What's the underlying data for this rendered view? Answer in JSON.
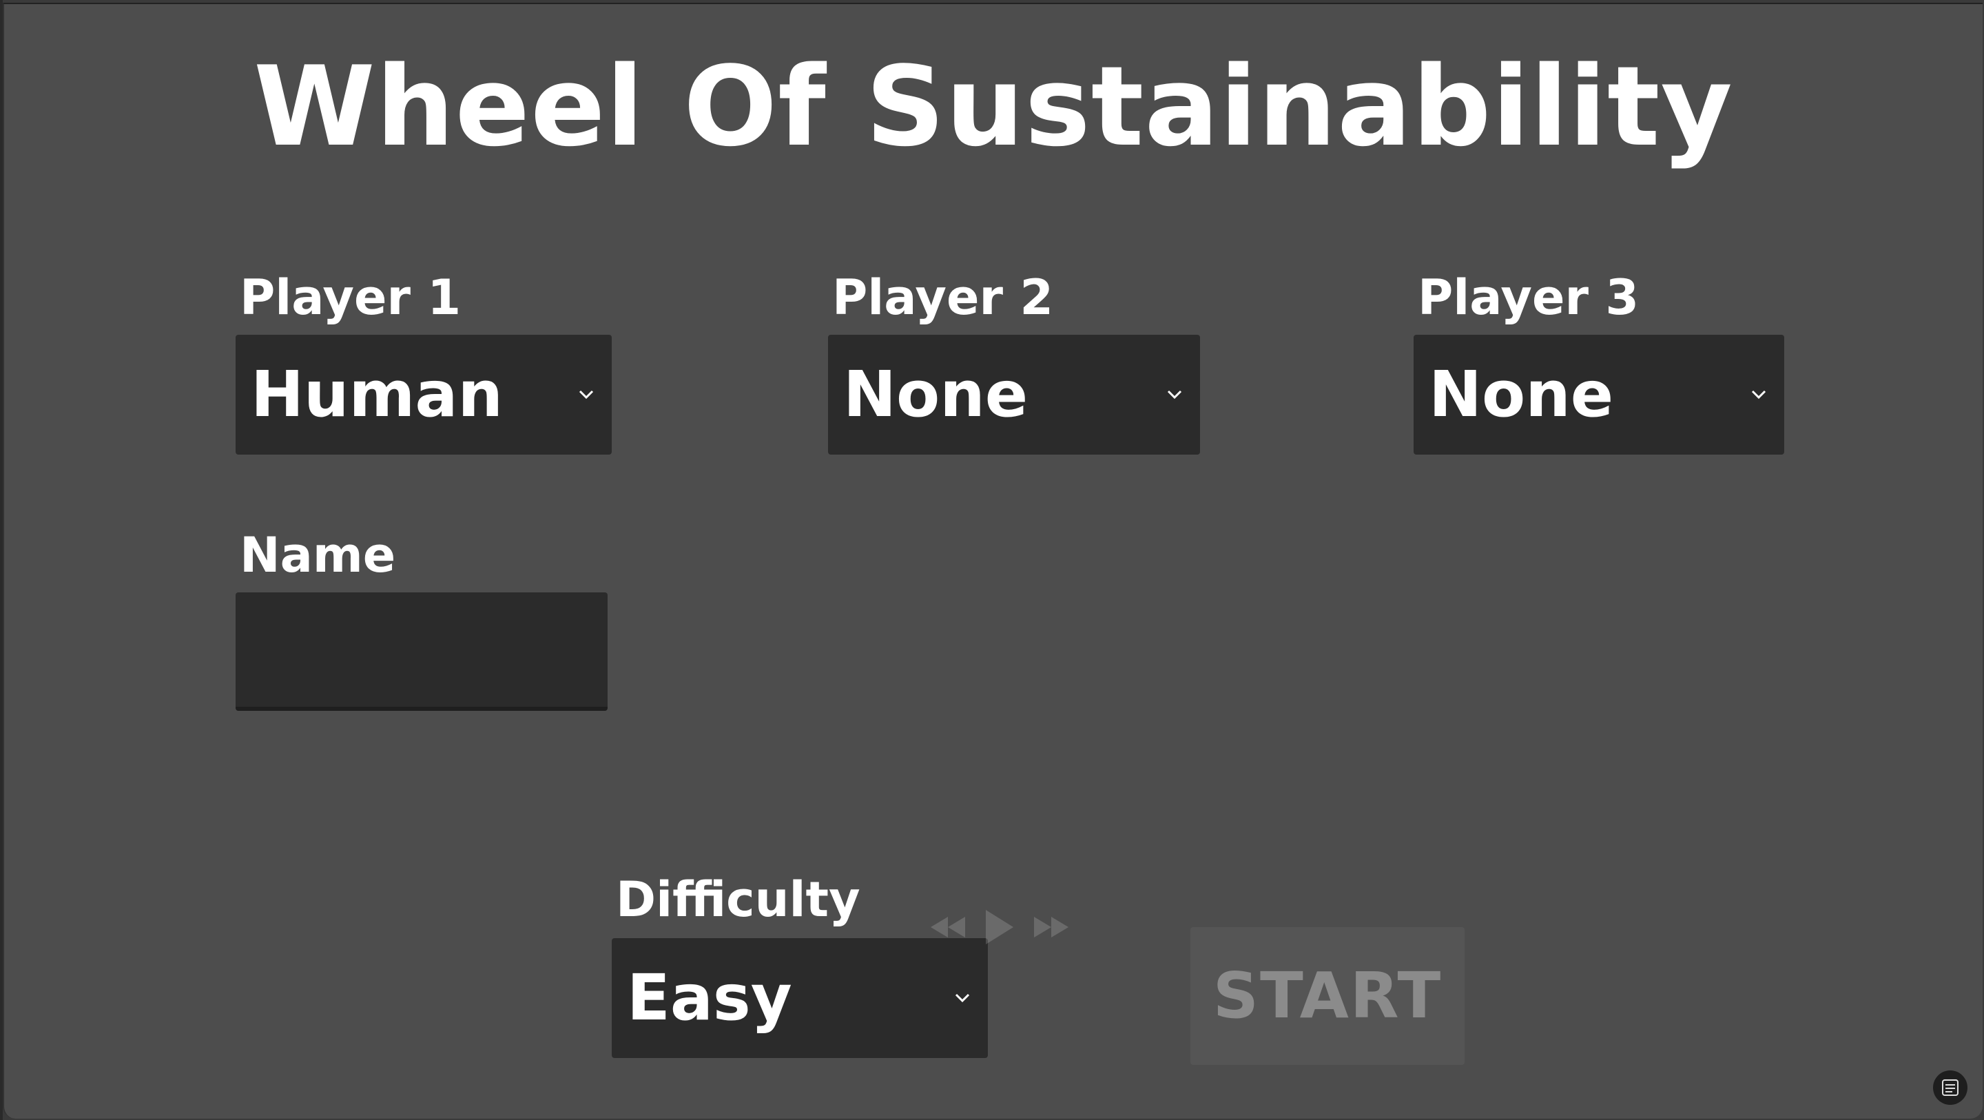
{
  "app": {
    "title": "Wheel Of Sustainability"
  },
  "players": [
    {
      "label": "Player 1",
      "selected": "Human"
    },
    {
      "label": "Player 2",
      "selected": "None"
    },
    {
      "label": "Player 3",
      "selected": "None"
    }
  ],
  "name_field": {
    "label": "Name",
    "value": ""
  },
  "difficulty": {
    "label": "Difficulty",
    "selected": "Easy"
  },
  "start_button": {
    "label": "START"
  },
  "icons": {
    "dropdown": "chevron-down-icon",
    "rewind": "rewind-icon",
    "play": "play-icon",
    "fast_forward": "fast-forward-icon",
    "corner": "text-recognition-icon"
  },
  "colors": {
    "background": "#4d4d4d",
    "control_bg": "#2b2b2b",
    "text": "#ffffff",
    "start_disabled_text": "#8b8b8b",
    "start_bg": "#555555"
  }
}
